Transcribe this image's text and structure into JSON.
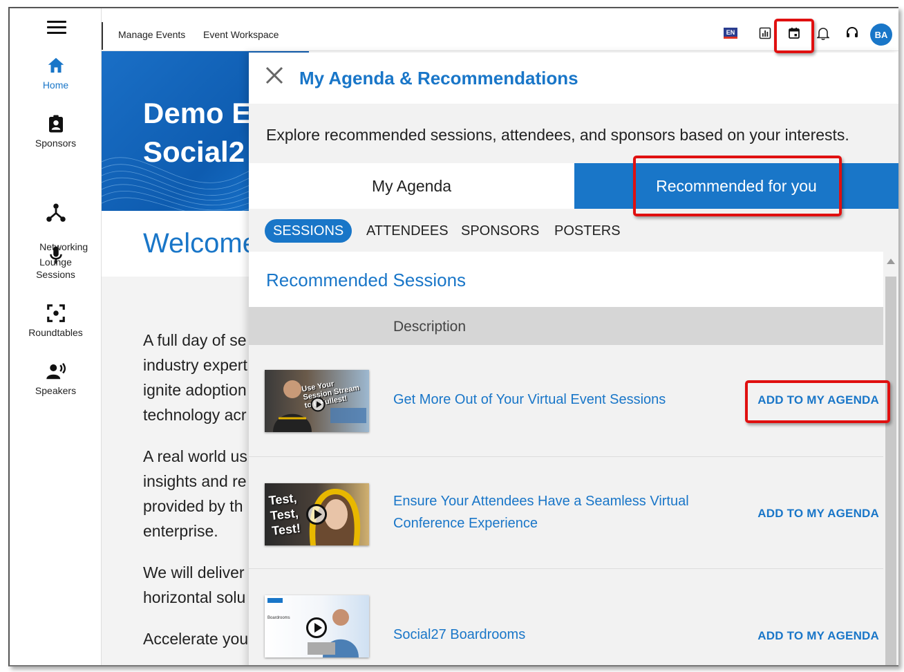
{
  "sidebar": {
    "items": [
      {
        "label": "Home",
        "icon": "home-icon"
      },
      {
        "label": "Sponsors",
        "icon": "badge-icon"
      },
      {
        "label": "Networking\nLounge",
        "icon": "network-icon"
      },
      {
        "label": "Sessions",
        "icon": "microphone-icon"
      },
      {
        "label": "Roundtables",
        "icon": "roundtable-icon"
      },
      {
        "label": "Speakers",
        "icon": "speaker-icon"
      }
    ]
  },
  "header": {
    "breadcrumbs": [
      "Manage Events",
      "Event Workspace"
    ],
    "language": "EN",
    "avatar_initials": "BA",
    "icons": [
      "language-flag-icon",
      "analytics-icon",
      "calendar-icon",
      "bell-icon",
      "headset-icon"
    ]
  },
  "background_page": {
    "hero_title": "Demo E\nSocial2",
    "welcome": "Welcome",
    "paragraphs": [
      "A full day of se\nindustry expert\nignite adoption\ntechnology acr",
      "A real world us\ninsights and re\nprovided by th\nenterprise.",
      "We will deliver\nhorizontal solu",
      "Accelerate you"
    ]
  },
  "panel": {
    "title": "My Agenda & Recommendations",
    "subtitle": "Explore recommended sessions, attendees, and sponsors based on your interests.",
    "tabs": [
      {
        "label": "My Agenda",
        "active": false
      },
      {
        "label": "Recommended for you",
        "active": true
      }
    ],
    "subtabs": [
      {
        "label": "SESSIONS",
        "active": true
      },
      {
        "label": "ATTENDEES",
        "active": false
      },
      {
        "label": "SPONSORS",
        "active": false
      },
      {
        "label": "POSTERS",
        "active": false
      }
    ],
    "section_title": "Recommended Sessions",
    "column_header": "Description",
    "sessions": [
      {
        "title": "Get More Out of Your Virtual Event Sessions",
        "action": "ADD TO MY AGENDA",
        "thumb_text": "Use Your\nSession Stream\nto it Fullest!"
      },
      {
        "title": "Ensure Your Attendees Have a Seamless Virtual\nConference Experience",
        "action": "ADD TO MY AGENDA",
        "thumb_text": "Test,\nTest,\nTest!"
      },
      {
        "title": "Social27 Boardrooms",
        "action": "ADD TO MY AGENDA",
        "thumb_text": "Boardrooms"
      }
    ]
  },
  "colors": {
    "accent": "#1976c8",
    "highlight": "#e01010",
    "panel_bg": "#f2f2f2"
  }
}
